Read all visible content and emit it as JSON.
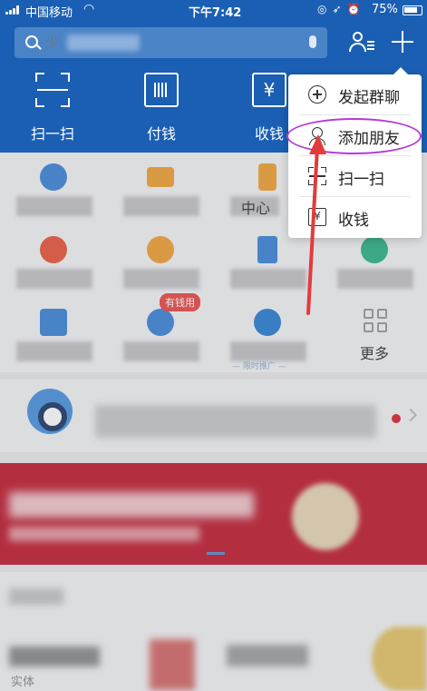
{
  "status_bar": {
    "carrier": "中国移动",
    "time": "下午7:42",
    "battery": "75%"
  },
  "search": {
    "placeholder": "少"
  },
  "quick_actions": [
    {
      "label": "扫一扫",
      "icon": "scan-icon"
    },
    {
      "label": "付钱",
      "icon": "barcode-icon"
    },
    {
      "label": "收钱",
      "icon": "yuan-icon"
    }
  ],
  "grid": {
    "visible_labels": {
      "row1_col3_suffix": "中心",
      "more": "更多"
    },
    "badge": "有钱用",
    "ad_tag": "— 限时推广 —"
  },
  "popup_menu": {
    "items": [
      {
        "label": "发起群聊",
        "icon": "circle-plus-icon"
      },
      {
        "label": "添加朋友",
        "icon": "person-plus-icon"
      },
      {
        "label": "扫一扫",
        "icon": "scan-icon"
      },
      {
        "label": "收钱",
        "icon": "yuan-collect-icon"
      }
    ]
  },
  "bottom": {
    "sub_label": "实体"
  },
  "colors": {
    "header_blue": "#1a5fb3",
    "banner_red": "#c01f33",
    "highlight_purple": "#b43ad6",
    "arrow_red": "#e23b3b"
  }
}
